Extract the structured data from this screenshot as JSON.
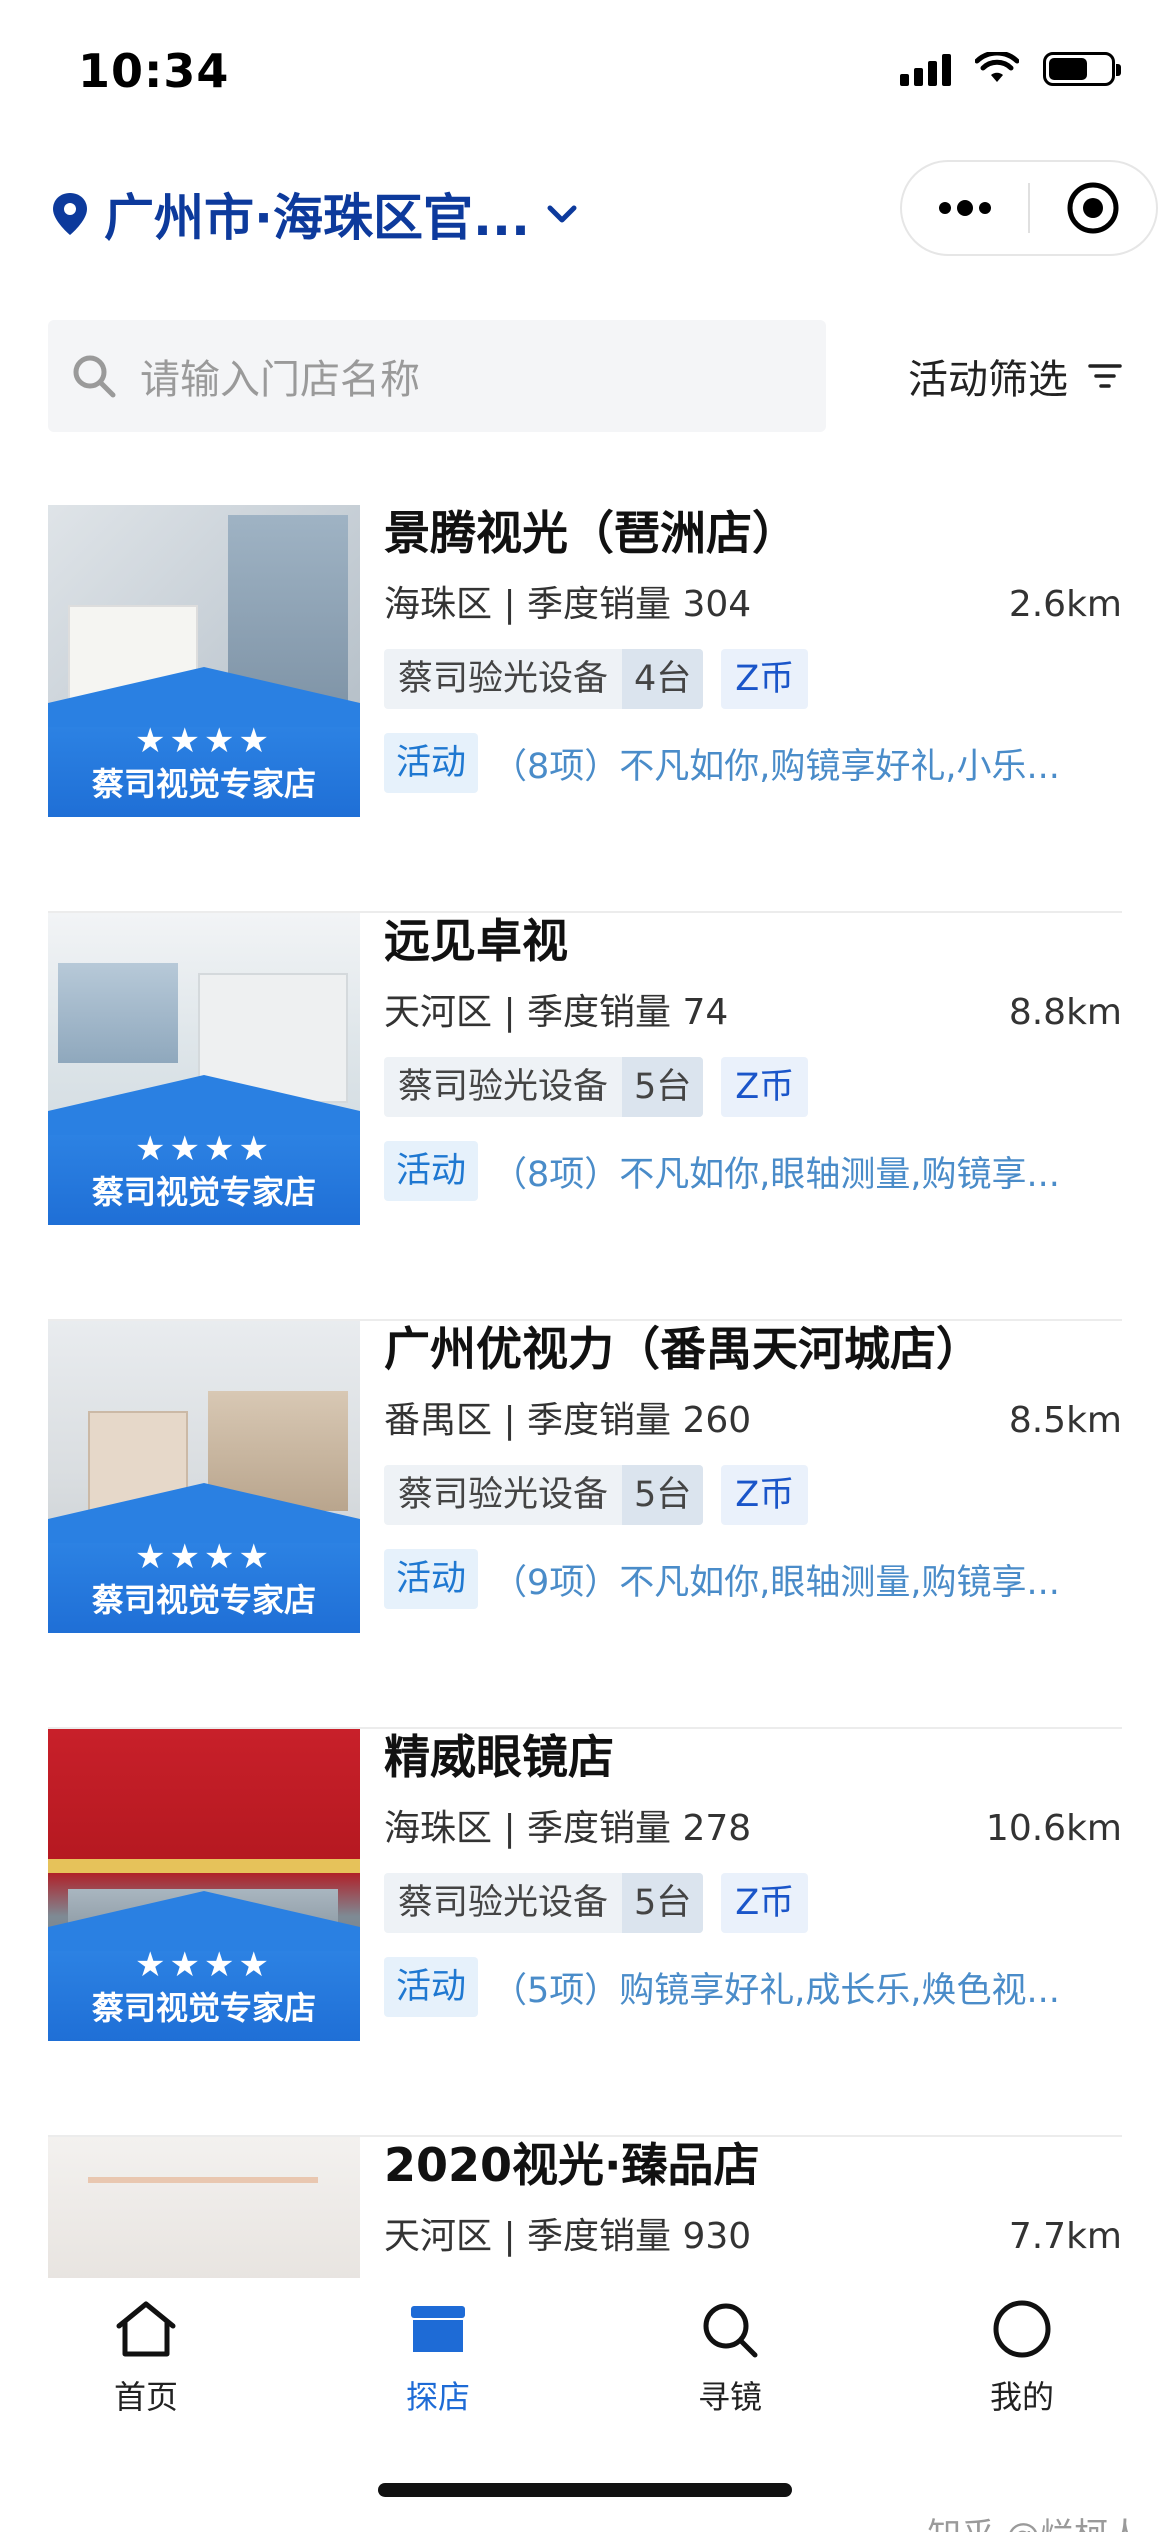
{
  "status_bar": {
    "time": "10:34"
  },
  "header": {
    "location": "广州市·海珠区官...",
    "icons": [
      "location-pin-icon",
      "chevron-down-icon",
      "more-dots-icon",
      "target-icon"
    ]
  },
  "search": {
    "placeholder": "请输入门店名称",
    "filter_label": "活动筛选"
  },
  "stores": [
    {
      "name": "景腾视光（琶洲店）",
      "district_sales": "海珠区 | 季度销量 304",
      "distance": "2.6km",
      "device_label": "蔡司验光设备",
      "device_count": "4台",
      "z_coin": "Z币",
      "activity_tag": "活动",
      "activity_text": "（8项）不凡如你,购镜享好礼,小乐...",
      "badge_label": "蔡司视觉专家店",
      "badge_stars": "★★★★"
    },
    {
      "name": "远见卓视",
      "district_sales": "天河区 | 季度销量 74",
      "distance": "8.8km",
      "device_label": "蔡司验光设备",
      "device_count": "5台",
      "z_coin": "Z币",
      "activity_tag": "活动",
      "activity_text": "（8项）不凡如你,眼轴测量,购镜享...",
      "badge_label": "蔡司视觉专家店",
      "badge_stars": "★★★★"
    },
    {
      "name": "广州优视力（番禺天河城店）",
      "district_sales": "番禺区 | 季度销量 260",
      "distance": "8.5km",
      "device_label": "蔡司验光设备",
      "device_count": "5台",
      "z_coin": "Z币",
      "activity_tag": "活动",
      "activity_text": "（9项）不凡如你,眼轴测量,购镜享...",
      "badge_label": "蔡司视觉专家店",
      "badge_stars": "★★★★"
    },
    {
      "name": "精威眼镜店",
      "district_sales": "海珠区 | 季度销量 278",
      "distance": "10.6km",
      "device_label": "蔡司验光设备",
      "device_count": "5台",
      "z_coin": "Z币",
      "activity_tag": "活动",
      "activity_text": "（5项）购镜享好礼,成长乐,焕色视...",
      "badge_label": "蔡司视觉专家店",
      "badge_stars": "★★★★"
    },
    {
      "name": "2020视光·臻品店",
      "district_sales": "天河区 | 季度销量 930",
      "distance": "7.7km"
    }
  ],
  "tabbar": {
    "items": [
      {
        "label": "首页",
        "icon": "home-icon"
      },
      {
        "label": "探店",
        "icon": "store-icon",
        "active": true
      },
      {
        "label": "寻镜",
        "icon": "search-icon"
      },
      {
        "label": "我的",
        "icon": "profile-circle-icon"
      }
    ],
    "watermark": "知乎 @烂柯人"
  },
  "colors": {
    "brand_blue": "#0d3a9c",
    "active_tab": "#1e6bd6",
    "activity_text": "#4a8cc9",
    "badge_blue": "#1f6fd6"
  }
}
